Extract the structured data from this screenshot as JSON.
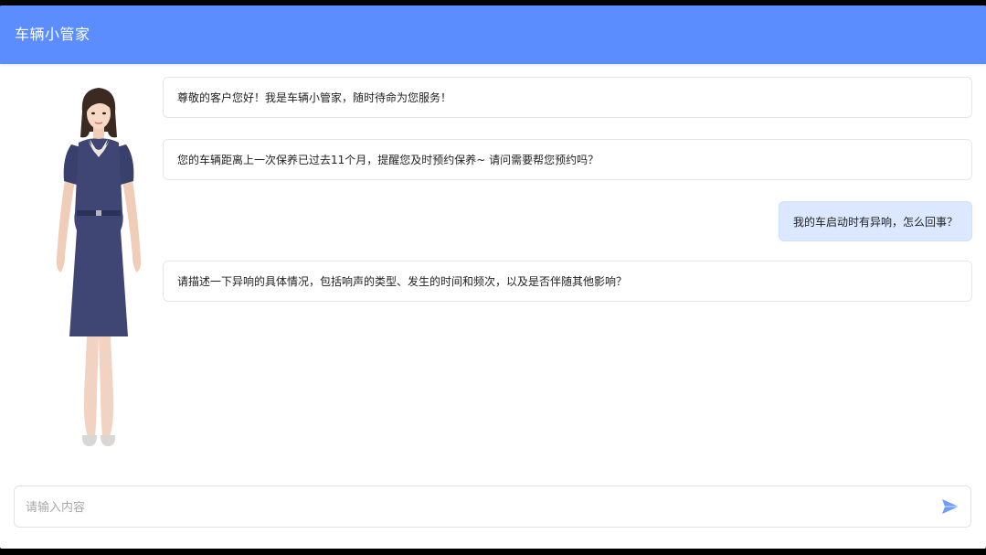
{
  "app": {
    "title": "车辆小管家",
    "accent_color": "#5b8dff"
  },
  "messages": [
    {
      "role": "bot",
      "text": "尊敬的客户您好！我是车辆小管家，随时待命为您服务！"
    },
    {
      "role": "bot",
      "text": "您的车辆距离上一次保养已过去11个月，提醒您及时预约保养~ 请问需要帮您预约吗？"
    },
    {
      "role": "user",
      "text": "我的车启动时有异响，怎么回事？"
    },
    {
      "role": "bot",
      "text": "请描述一下异响的具体情况，包括响声的类型、发生的时间和频次，以及是否伴随其他影响？"
    }
  ],
  "input": {
    "value": "",
    "placeholder": "请输入内容"
  },
  "icons": {
    "send": "send-icon",
    "avatar": "assistant-avatar"
  }
}
